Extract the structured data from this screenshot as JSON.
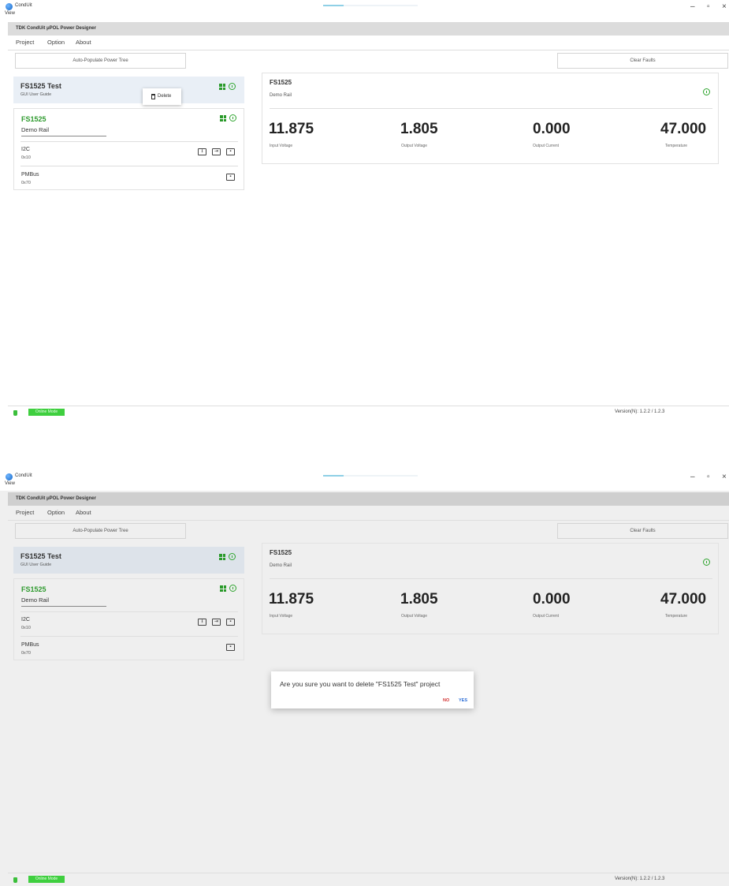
{
  "window": {
    "app_name": "CondUit",
    "view_menu": "View",
    "progress": 0.22,
    "minimize": "–",
    "maximize": "▫",
    "close": "×"
  },
  "app_title": "TDK CondUit μPOL Power Designer",
  "menu": {
    "project": "Project",
    "option": "Option",
    "about": "About"
  },
  "toolbar": {
    "auto_populate": "Auto-Populate Power Tree",
    "clear_faults": "Clear Faults"
  },
  "tree": {
    "project_name": "FS1525 Test",
    "project_subtitle": "GUI User Guide",
    "rail_name": "FS1525",
    "rail_field_value": "Demo Rail",
    "buses": [
      {
        "title": "I2C",
        "address": "0x10"
      },
      {
        "title": "PMBus",
        "address": "0x70"
      }
    ],
    "status_color": "#2e9a2e"
  },
  "context_menu": {
    "delete_label": "Delete"
  },
  "detail": {
    "title": "FS1525",
    "subtitle": "Demo Rail",
    "metrics": [
      {
        "value": "11.875",
        "label": "Input Voltage"
      },
      {
        "value": "1.805",
        "label": "Output Voltage"
      },
      {
        "value": "0.000",
        "label": "Output Current"
      },
      {
        "value": "47.000",
        "label": "Temperature"
      }
    ]
  },
  "status": {
    "mode": "Online Mode",
    "version": "Version(N): 1.2.2 / 1.2.3",
    "mode_color": "#3fcf3f"
  },
  "dialog": {
    "message": "Are you sure you want to delete \"FS1525 Test\" project",
    "no": "NO",
    "yes": "YES"
  }
}
